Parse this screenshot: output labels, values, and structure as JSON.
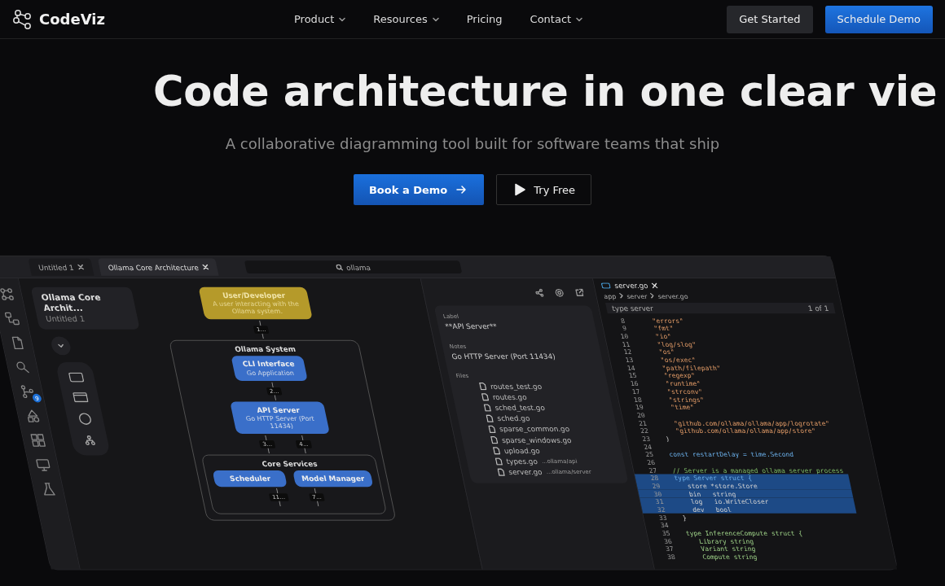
{
  "nav": {
    "brand": "CodeViz",
    "menu": [
      {
        "label": "Product",
        "dropdown": true
      },
      {
        "label": "Resources",
        "dropdown": true
      },
      {
        "label": "Pricing",
        "dropdown": false
      },
      {
        "label": "Contact",
        "dropdown": true
      }
    ],
    "buttons": [
      {
        "label": "Get Started",
        "kind": "secondary"
      },
      {
        "label": "Schedule Demo",
        "kind": "primary"
      }
    ]
  },
  "hero": {
    "title": "Code architecture in one clear vie",
    "subtitle": "A collaborative diagramming tool built for software teams that ship",
    "actions": [
      {
        "label": "Book a Demo",
        "kind": "primary"
      },
      {
        "label": "Try Free",
        "kind": "outline"
      }
    ]
  },
  "app": {
    "tabs": [
      {
        "label": "Untitled 1",
        "selected": false
      },
      {
        "label": "Ollama Core Architecture",
        "selected": true
      }
    ],
    "search": {
      "value": "ollama"
    },
    "activity_badge": "9",
    "document": {
      "title": "Ollama Core Archit...",
      "subtitle": "Untitled 1"
    },
    "diagram": [
      {
        "kind": "actor",
        "title": "User/Developer",
        "description": "A user interacting with the Ollama system."
      },
      {
        "kind": "edges",
        "labels": [
          "1..."
        ]
      },
      {
        "kind": "group",
        "title": "Ollama System",
        "children": [
          {
            "kind": "service",
            "title": "CLI Interface",
            "description": "Go Application"
          },
          {
            "kind": "edges",
            "labels": [
              "2..."
            ]
          },
          {
            "kind": "service",
            "title": "API Server",
            "description": "Go HTTP Server (Port 11434)"
          },
          {
            "kind": "edges",
            "labels": [
              "3...",
              "4..."
            ]
          },
          {
            "kind": "group",
            "title": "Core Services",
            "children": [
              {
                "kind": "row",
                "children": [
                  {
                    "kind": "service",
                    "title": "Scheduler"
                  },
                  {
                    "kind": "service",
                    "title": "Model Manager"
                  }
                ]
              },
              {
                "kind": "edges",
                "labels": [
                  "11...",
                  "7..."
                ]
              }
            ]
          }
        ]
      }
    ],
    "properties": {
      "fields": [
        {
          "label": "Label",
          "value": "**API Server**"
        },
        {
          "label": "Notes",
          "value": "Go HTTP Server (Port 11434)"
        }
      ],
      "files_label": "Files",
      "files": [
        {
          "name": "routes_test.go"
        },
        {
          "name": "routes.go"
        },
        {
          "name": "sched_test.go"
        },
        {
          "name": "sched.go"
        },
        {
          "name": "sparse_common.go"
        },
        {
          "name": "sparse_windows.go"
        },
        {
          "name": "upload.go"
        },
        {
          "name": "types.go",
          "path": "...ollama/api"
        },
        {
          "name": "server.go",
          "path": "...ollama/server"
        }
      ]
    },
    "editor": {
      "tab": "server.go",
      "breadcrumb": [
        "app",
        "server",
        "server.go"
      ],
      "find": {
        "value": "type server",
        "count": "1 of 1"
      },
      "lines": [
        {
          "number": "8",
          "text": "\t\"errors\"",
          "kind": "string",
          "selected": false
        },
        {
          "number": "9",
          "text": "\t\"fmt\"",
          "kind": "string",
          "selected": false
        },
        {
          "number": "10",
          "text": "\t\"io\"",
          "kind": "string",
          "selected": false
        },
        {
          "number": "11",
          "text": "\t\"log/slog\"",
          "kind": "string",
          "selected": false
        },
        {
          "number": "12",
          "text": "\t\"os\"",
          "kind": "string",
          "selected": false
        },
        {
          "number": "13",
          "text": "\t\"os/exec\"",
          "kind": "string",
          "selected": false
        },
        {
          "number": "14",
          "text": "\t\"path/filepath\"",
          "kind": "string",
          "selected": false
        },
        {
          "number": "15",
          "text": "\t\"regexp\"",
          "kind": "string",
          "selected": false
        },
        {
          "number": "16",
          "text": "\t\"runtime\"",
          "kind": "string",
          "selected": false
        },
        {
          "number": "17",
          "text": "\t\"strconv\"",
          "kind": "string",
          "selected": false
        },
        {
          "number": "18",
          "text": "\t\"strings\"",
          "kind": "string",
          "selected": false
        },
        {
          "number": "19",
          "text": "\t\"time\"",
          "kind": "string",
          "selected": false
        },
        {
          "number": "20",
          "selected": false
        },
        {
          "number": "21",
          "text": "\t\"github.com/ollama/ollama/app/logrotate\"",
          "kind": "string",
          "selected": false
        },
        {
          "number": "22",
          "text": "\t\"github.com/ollama/ollama/app/store\"",
          "kind": "string",
          "selected": false
        },
        {
          "number": "23",
          "text": ")",
          "kind": "code",
          "selected": false
        },
        {
          "number": "24",
          "selected": false
        },
        {
          "number": "25",
          "text": "const restartDelay = time.Second",
          "kind": "keyword",
          "selected": false
        },
        {
          "number": "26",
          "selected": false
        },
        {
          "number": "27",
          "text": "// Server is a managed ollama server process",
          "kind": "comment",
          "selected": false
        },
        {
          "number": "28",
          "text": "type Server struct {",
          "kind": "keyword",
          "selected": true
        },
        {
          "number": "29",
          "text": "\tstore *store.Store",
          "kind": "code",
          "selected": true
        },
        {
          "number": "30",
          "text": "\tbin   string",
          "kind": "code",
          "selected": true
        },
        {
          "number": "31",
          "text": "\tlog   io.WriteCloser",
          "kind": "code",
          "selected": true
        },
        {
          "number": "32",
          "text": "\tdev   bool",
          "kind": "code",
          "selected": true
        },
        {
          "number": "33",
          "text": "}",
          "kind": "code",
          "selected": false
        },
        {
          "number": "34",
          "selected": false
        },
        {
          "number": "35",
          "text": "type InferenceCompute struct {",
          "kind": "type",
          "selected": false
        },
        {
          "number": "36",
          "text": "\tLibrary string",
          "kind": "type",
          "selected": false
        },
        {
          "number": "37",
          "text": "\tVariant string",
          "kind": "type",
          "selected": false
        },
        {
          "number": "38",
          "text": "\tCompute string",
          "kind": "type",
          "selected": false
        }
      ]
    }
  }
}
